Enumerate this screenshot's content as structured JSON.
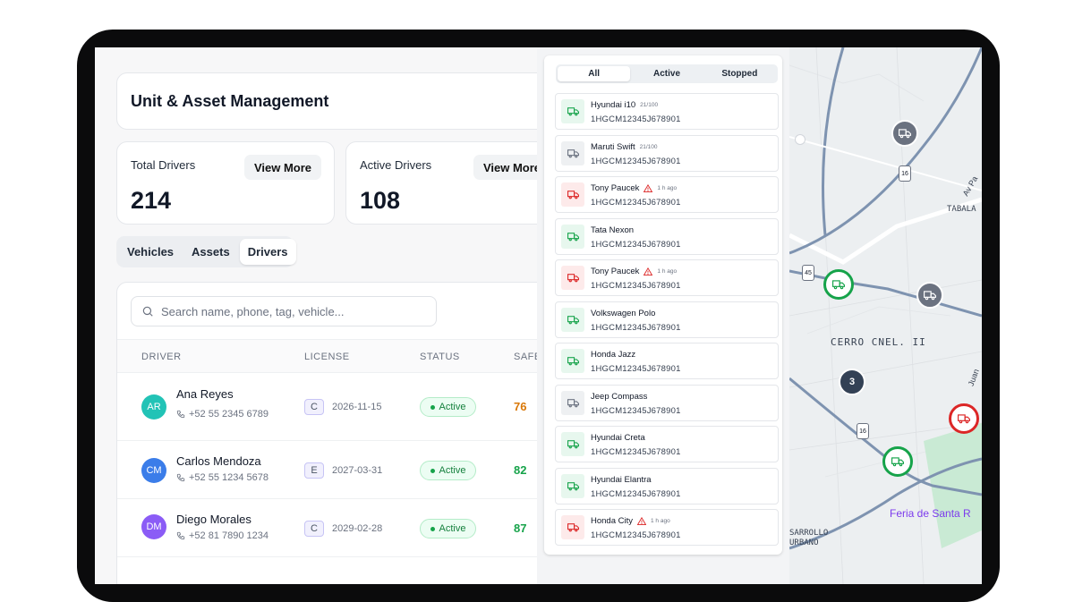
{
  "header": {
    "title": "Unit & Asset Management"
  },
  "stats": [
    {
      "label": "Total Drivers",
      "value": "214",
      "action": "View More"
    },
    {
      "label": "Active Drivers",
      "value": "108",
      "action": "View More"
    }
  ],
  "tabs": [
    "Vehicles",
    "Assets",
    "Drivers"
  ],
  "search": {
    "placeholder": "Search name, phone, tag, vehicle..."
  },
  "table": {
    "columns": [
      "DRIVER",
      "LICENSE",
      "STATUS",
      "SAFE"
    ],
    "rows": [
      {
        "initials": "AR",
        "name": "Ana Reyes",
        "phone": "+52 55 2345 6789",
        "license_class": "C",
        "license_date": "2026-11-15",
        "status": "Active",
        "safety": "76",
        "avatar_color": "#22c3b6",
        "safety_color": "#d97706"
      },
      {
        "initials": "CM",
        "name": "Carlos Mendoza",
        "phone": "+52 55 1234 5678",
        "license_class": "E",
        "license_date": "2027-03-31",
        "status": "Active",
        "safety": "82",
        "avatar_color": "#3b7de9",
        "safety_color": "#16a34a"
      },
      {
        "initials": "DM",
        "name": "Diego Morales",
        "phone": "+52 81 7890 1234",
        "license_class": "C",
        "license_date": "2029-02-28",
        "status": "Active",
        "safety": "87",
        "avatar_color": "#8b5cf6",
        "safety_color": "#16a34a"
      }
    ]
  },
  "vehicle_panel": {
    "filters": [
      "All",
      "Active",
      "Stopped"
    ],
    "selected_filter": "All",
    "items": [
      {
        "name": "Hyundai i10",
        "meta": "21/100",
        "vin": "1HGCM12345J678901",
        "state": "moving",
        "alert": false
      },
      {
        "name": "Maruti Swift",
        "meta": "21/100",
        "vin": "1HGCM12345J678901",
        "state": "stopped",
        "alert": false
      },
      {
        "name": "Tony Paucek",
        "meta": "1 h ago",
        "vin": "1HGCM12345J678901",
        "state": "alert",
        "alert": true
      },
      {
        "name": "Tata Nexon",
        "meta": "",
        "vin": "1HGCM12345J678901",
        "state": "moving",
        "alert": false
      },
      {
        "name": "Tony Paucek",
        "meta": "1 h ago",
        "vin": "1HGCM12345J678901",
        "state": "alert",
        "alert": true
      },
      {
        "name": "Volkswagen Polo",
        "meta": "",
        "vin": "1HGCM12345J678901",
        "state": "moving",
        "alert": false
      },
      {
        "name": "Honda Jazz",
        "meta": "",
        "vin": "1HGCM12345J678901",
        "state": "moving",
        "alert": false
      },
      {
        "name": "Jeep Compass",
        "meta": "",
        "vin": "1HGCM12345J678901",
        "state": "stopped",
        "alert": false
      },
      {
        "name": "Hyundai Creta",
        "meta": "",
        "vin": "1HGCM12345J678901",
        "state": "moving",
        "alert": false
      },
      {
        "name": "Hyundai Elantra",
        "meta": "",
        "vin": "1HGCM12345J678901",
        "state": "moving",
        "alert": false
      },
      {
        "name": "Honda City",
        "meta": "1 h ago",
        "vin": "1HGCM12345J678901",
        "state": "alert",
        "alert": true
      }
    ]
  },
  "map": {
    "labels": [
      "CERRO CNEL. II",
      "TABALA",
      "Av Pa",
      "Juan",
      "Feria de Santa R",
      "SARROLLO",
      "URBANO"
    ],
    "road_shields": [
      "45",
      "16",
      "16"
    ],
    "cluster_count": "3"
  },
  "colors": {
    "moving": "#16a34a",
    "stopped": "#6b7280",
    "alert": "#dc2626"
  }
}
